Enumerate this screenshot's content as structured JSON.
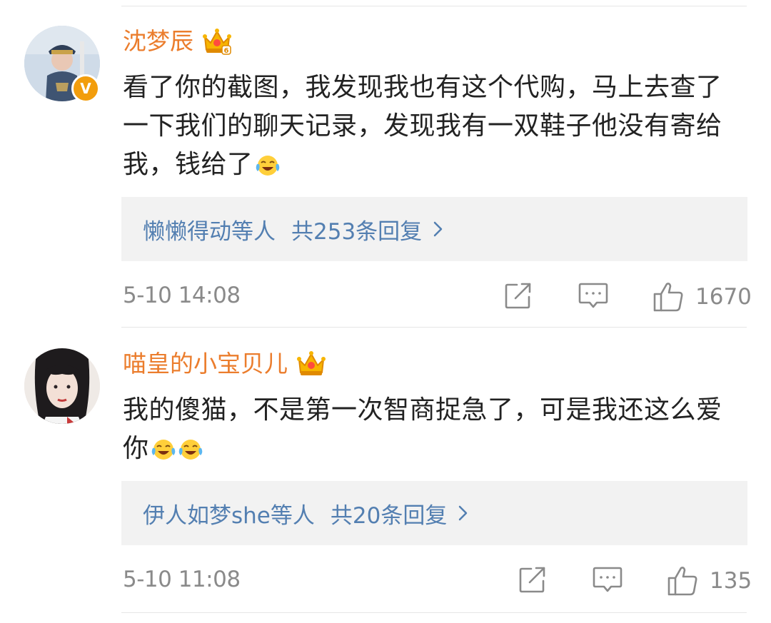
{
  "comments": [
    {
      "username": "沈梦辰",
      "verified_badge": "V",
      "text": "看了你的截图，我发现我也有这个代购，马上去查了一下我们的聊天记录，发现我有一双鞋子他没有寄给我，钱给了",
      "emojis": [
        "laugh-cry-emoji"
      ],
      "reply_names": "懒懒得动",
      "reply_suffix": "等人",
      "reply_count": "共253条回复",
      "timestamp": "5-10 14:08",
      "likes": "1670"
    },
    {
      "username": "喵皇的小宝贝儿",
      "text": "我的傻猫，不是第一次智商捉急了，可是我还这么爱你",
      "emojis": [
        "laugh-cry-emoji",
        "laugh-cry-emoji"
      ],
      "reply_names": "伊人如梦she",
      "reply_suffix": "等人",
      "reply_count": "共20条回复",
      "timestamp": "5-10 11:08",
      "likes": "135"
    }
  ],
  "colors": {
    "username": "#eb7d2d",
    "link": "#537fb1",
    "meta": "#8a8a8a",
    "text": "#222222",
    "reply_bg": "#f2f2f2",
    "verified": "#f29d0c"
  },
  "icons": [
    "crown-vip-icon",
    "share-icon",
    "comment-icon",
    "like-icon",
    "chevron-right-icon"
  ]
}
